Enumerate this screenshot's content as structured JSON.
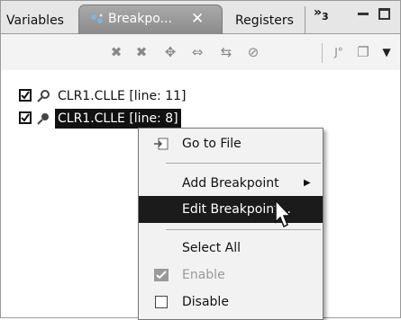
{
  "tabs": {
    "variables": "Variables",
    "breakpoints": "Breakpo...",
    "close": "✕",
    "registers": "Registers",
    "more": "»",
    "more_count": "3"
  },
  "breakpoints": [
    {
      "label": "CLR1.CLLE [line: 11]",
      "checked": true
    },
    {
      "label": "CLR1.CLLE [line: 8]",
      "checked": true,
      "selected": true
    }
  ],
  "context_menu": {
    "go_to_file": "Go to File",
    "add_breakpoint": "Add Breakpoint",
    "edit_breakpoint": "Edit Breakpoint...",
    "select_all": "Select All",
    "enable": "Enable",
    "disable": "Disable"
  },
  "toolbar_icons": [
    "remove-icon",
    "remove-all-icon",
    "skip-all-icon",
    "link-icon",
    "collapse-icon",
    "skip-breakpoints-icon",
    "show-types-icon",
    "copy-icon",
    "view-menu-icon"
  ]
}
